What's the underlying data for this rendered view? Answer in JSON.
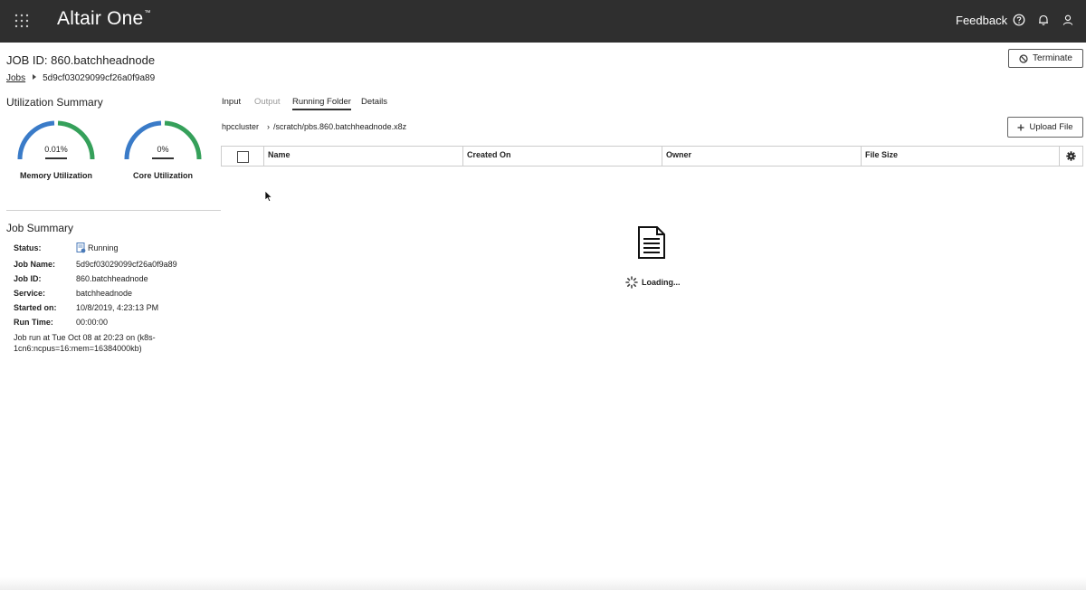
{
  "topbar": {
    "brand": "Altair One",
    "trademark": "™",
    "feedback_label": "Feedback",
    "icons": [
      "apps-grid-icon",
      "help-icon",
      "bell-icon",
      "user-icon"
    ]
  },
  "header": {
    "job_title": "JOB ID: 860.batchheadnode",
    "breadcrumb": {
      "root": "Jobs",
      "current": "5d9cf03029099cf26a0f9a89"
    },
    "terminate_label": "Terminate"
  },
  "utilization": {
    "title": "Utilization Summary",
    "gauges": [
      {
        "value": "0.01%",
        "label": "Memory Utilization",
        "level": 0.0001
      },
      {
        "value": "0%",
        "label": "Core Utilization",
        "level": 0
      }
    ],
    "colors": {
      "blue": "#3a7bc8",
      "green": "#35a05a"
    }
  },
  "job_summary": {
    "title": "Job Summary",
    "fields": [
      {
        "label": "Status:",
        "value": "Running"
      },
      {
        "label": "Job Name:",
        "value": "5d9cf03029099cf26a0f9a89"
      },
      {
        "label": "Job ID:",
        "value": "860.batchheadnode"
      },
      {
        "label": "Service:",
        "value": "batchheadnode"
      },
      {
        "label": "Started on:",
        "value": "10/8/2019, 4:23:13 PM"
      },
      {
        "label": "Run Time:",
        "value": "00:00:00"
      }
    ],
    "note": "Job run at Tue Oct 08 at 20:23 on (k8s-1cn6:ncpus=16:mem=16384000kb)"
  },
  "tabs": [
    {
      "label": "Input",
      "state": "normal"
    },
    {
      "label": "Output",
      "state": "disabled"
    },
    {
      "label": "Running Folder",
      "state": "active"
    },
    {
      "label": "Details",
      "state": "normal"
    }
  ],
  "folder": {
    "cluster": "hpccluster",
    "path": "/scratch/pbs.860.batchheadnode.x8z",
    "upload_label": "Upload File",
    "columns": [
      "Name",
      "Created On",
      "Owner",
      "File Size"
    ],
    "loading_text": "Loading..."
  }
}
